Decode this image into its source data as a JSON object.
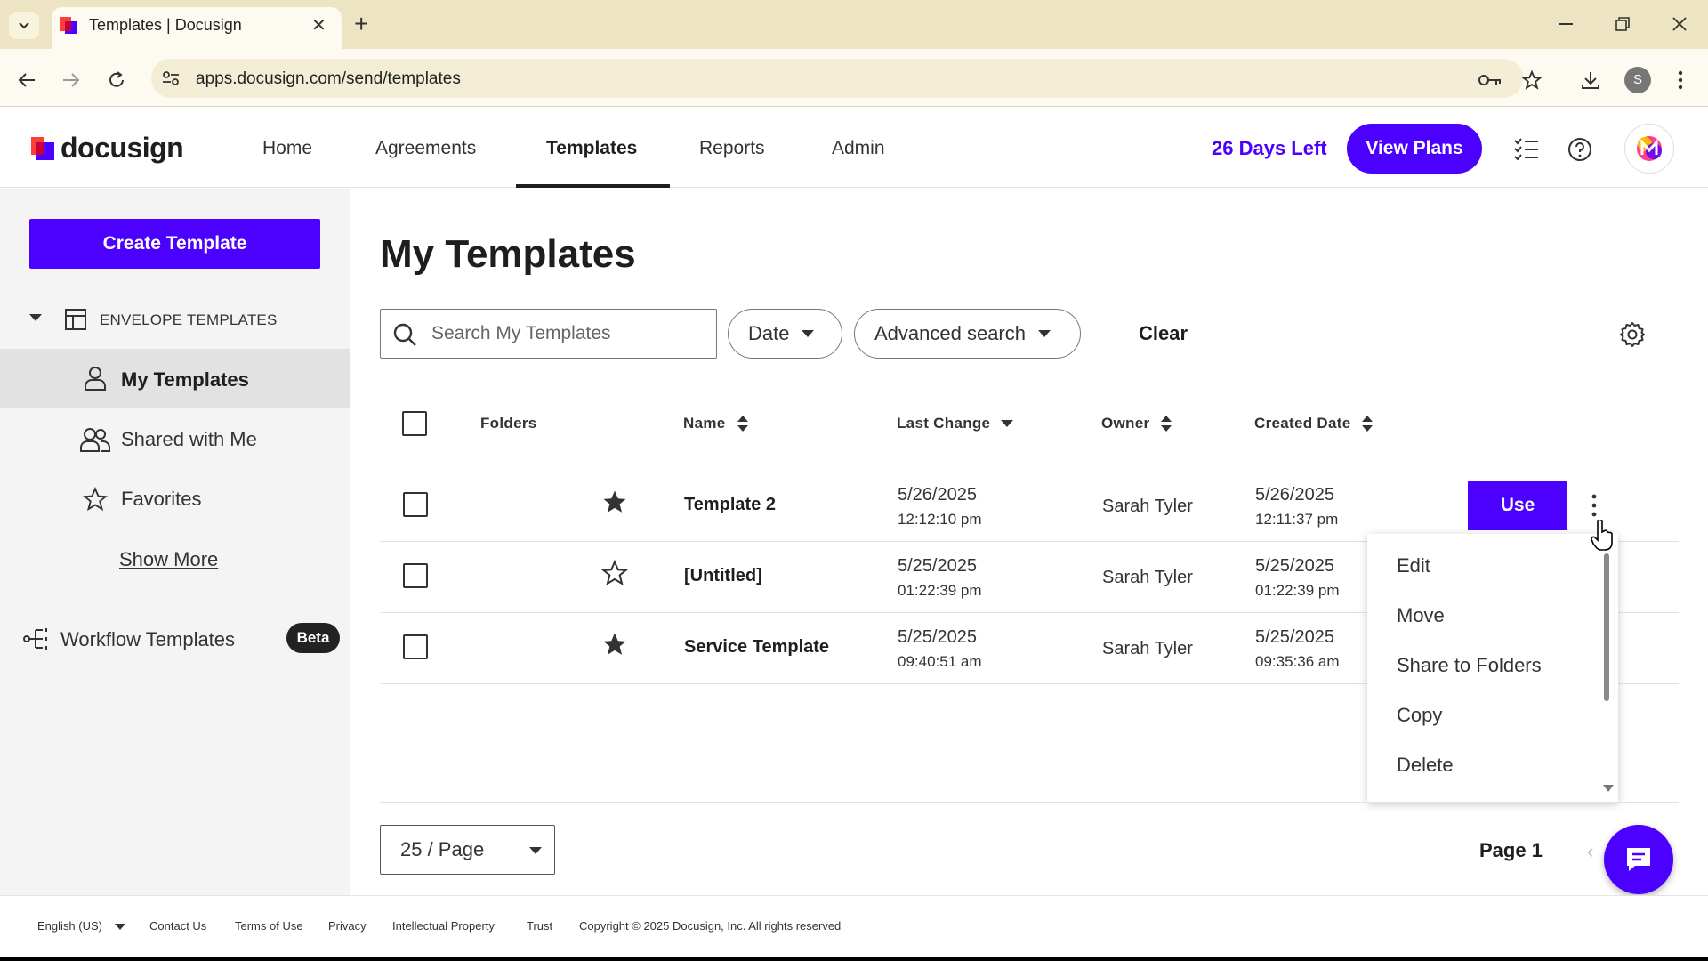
{
  "browser": {
    "tab_title": "Templates | Docusign",
    "url": "apps.docusign.com/send/templates",
    "profile_initial": "S",
    "new_tab": "+",
    "close_glyph": "✕"
  },
  "header": {
    "logo_text": "docusign",
    "nav": [
      "Home",
      "Agreements",
      "Templates",
      "Reports",
      "Admin"
    ],
    "active_nav": "Templates",
    "days_left": "26 Days Left",
    "view_plans": "View Plans",
    "brand_color": "#4c00ff"
  },
  "sidebar": {
    "create_template": "Create Template",
    "section_label": "ENVELOPE TEMPLATES",
    "items": [
      "My Templates",
      "Shared with Me",
      "Favorites"
    ],
    "show_more": "Show More",
    "workflow_templates": "Workflow Templates",
    "beta_badge": "Beta"
  },
  "main": {
    "title": "My Templates",
    "search_placeholder": "Search My Templates",
    "date_filter": "Date",
    "advanced_search": "Advanced search",
    "clear": "Clear",
    "columns": {
      "folders": "Folders",
      "name": "Name",
      "last_change": "Last Change",
      "owner": "Owner",
      "created_date": "Created Date"
    },
    "rows": [
      {
        "starred": true,
        "name": "Template 2",
        "last_change_date": "5/26/2025",
        "last_change_time": "12:12:10 pm",
        "owner": "Sarah Tyler",
        "created_date": "5/26/2025",
        "created_time": "12:11:37 pm"
      },
      {
        "starred": false,
        "name": "[Untitled]",
        "last_change_date": "5/25/2025",
        "last_change_time": "01:22:39 pm",
        "owner": "Sarah Tyler",
        "created_date": "5/25/2025",
        "created_time": "01:22:39 pm"
      },
      {
        "starred": true,
        "name": "Service Template",
        "last_change_date": "5/25/2025",
        "last_change_time": "09:40:51 am",
        "owner": "Sarah Tyler",
        "created_date": "5/25/2025",
        "created_time": "09:35:36 am"
      }
    ],
    "use_button": "Use",
    "menu_items": [
      "Edit",
      "Move",
      "Share to Folders",
      "Copy",
      "Delete"
    ],
    "per_page": "25 / Page",
    "page_label": "Page 1",
    "prev_arrow": "‹"
  },
  "footer": {
    "language": "English (US)",
    "links": [
      "Contact Us",
      "Terms of Use",
      "Privacy",
      "Intellectual Property",
      "Trust"
    ],
    "copyright": "Copyright © 2025 Docusign, Inc. All rights reserved"
  }
}
